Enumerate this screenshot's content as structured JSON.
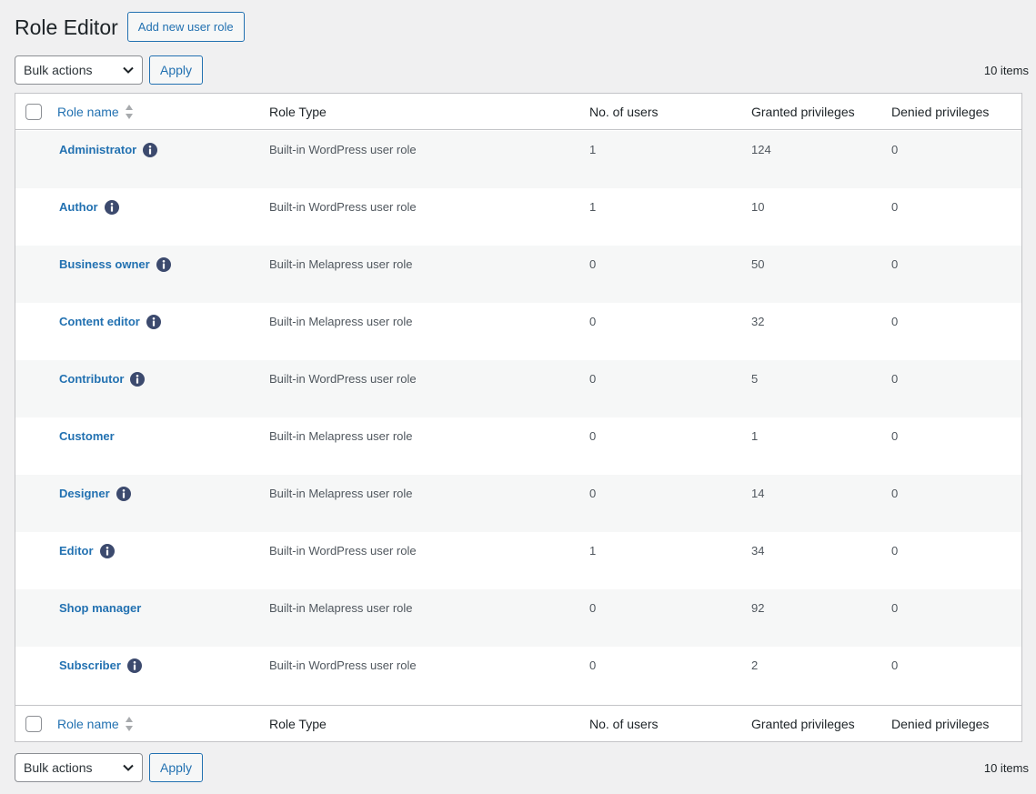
{
  "header": {
    "title": "Role Editor",
    "add_button": "Add new user role"
  },
  "tablenav": {
    "bulk_actions": "Bulk actions",
    "apply": "Apply",
    "items_count": "10 items"
  },
  "columns": {
    "name": "Role name",
    "type": "Role Type",
    "users": "No. of users",
    "granted": "Granted privileges",
    "denied": "Denied privileges"
  },
  "rows": [
    {
      "name": "Administrator",
      "info": true,
      "type": "Built-in WordPress user role",
      "users": "1",
      "granted": "124",
      "denied": "0"
    },
    {
      "name": "Author",
      "info": true,
      "type": "Built-in WordPress user role",
      "users": "1",
      "granted": "10",
      "denied": "0"
    },
    {
      "name": "Business owner",
      "info": true,
      "type": "Built-in Melapress user role",
      "users": "0",
      "granted": "50",
      "denied": "0"
    },
    {
      "name": "Content editor",
      "info": true,
      "type": "Built-in Melapress user role",
      "users": "0",
      "granted": "32",
      "denied": "0"
    },
    {
      "name": "Contributor",
      "info": true,
      "type": "Built-in WordPress user role",
      "users": "0",
      "granted": "5",
      "denied": "0"
    },
    {
      "name": "Customer",
      "info": false,
      "type": "Built-in Melapress user role",
      "users": "0",
      "granted": "1",
      "denied": "0"
    },
    {
      "name": "Designer",
      "info": true,
      "type": "Built-in Melapress user role",
      "users": "0",
      "granted": "14",
      "denied": "0"
    },
    {
      "name": "Editor",
      "info": true,
      "type": "Built-in WordPress user role",
      "users": "1",
      "granted": "34",
      "denied": "0"
    },
    {
      "name": "Shop manager",
      "info": false,
      "type": "Built-in Melapress user role",
      "users": "0",
      "granted": "92",
      "denied": "0"
    },
    {
      "name": "Subscriber",
      "info": true,
      "type": "Built-in WordPress user role",
      "users": "0",
      "granted": "2",
      "denied": "0"
    }
  ],
  "colors": {
    "accent": "#2271b1",
    "info_icon": "#3c4a6e",
    "alt_row": "#f6f7f7",
    "background": "#f0f0f1"
  }
}
